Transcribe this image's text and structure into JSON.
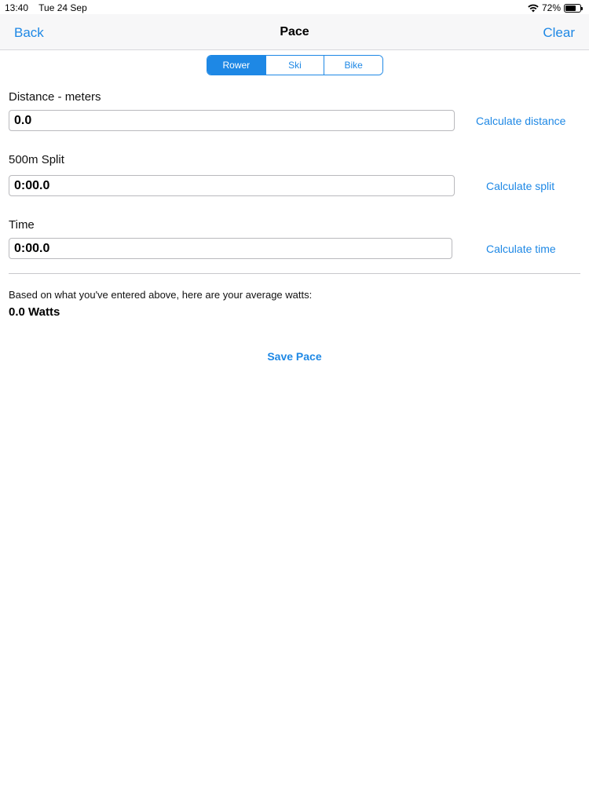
{
  "status_bar": {
    "time": "13:40",
    "date": "Tue 24 Sep",
    "battery": "72%",
    "battery_level": 0.72
  },
  "nav": {
    "back": "Back",
    "title": "Pace",
    "clear": "Clear"
  },
  "segments": [
    {
      "label": "Rower",
      "selected": true
    },
    {
      "label": "Ski",
      "selected": false
    },
    {
      "label": "Bike",
      "selected": false
    }
  ],
  "fields": {
    "distance": {
      "label": "Distance - meters",
      "value": "0.0",
      "action": "Calculate distance"
    },
    "split": {
      "label": "500m Split",
      "value": "0:00.0",
      "action": "Calculate split"
    },
    "time": {
      "label": "Time",
      "value": "0:00.0",
      "action": "Calculate time"
    }
  },
  "watts": {
    "caption": "Based on what you've entered above, here are your average watts:",
    "value": "0.0 Watts"
  },
  "save_pace": "Save Pace",
  "colors": {
    "accent": "#1e88e5",
    "nav_background": "#f7f7f8"
  }
}
